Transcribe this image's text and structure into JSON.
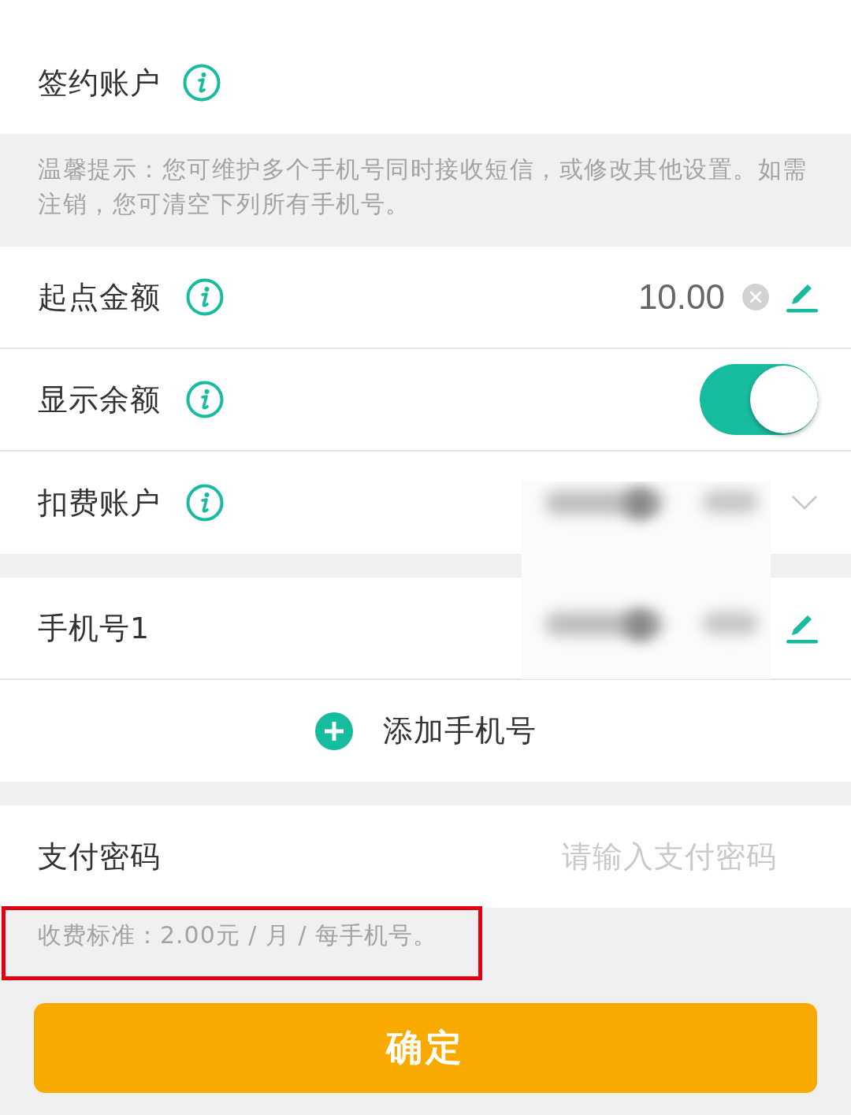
{
  "signing_account": {
    "label": "签约账户",
    "info": true
  },
  "tip": "温馨提示：您可维护多个手机号同时接收短信，或修改其他设置。如需注销，您可清空下列所有手机号。",
  "settings": [
    {
      "kind": "amount",
      "label": "起点金额",
      "info": true,
      "value": "10.00"
    },
    {
      "kind": "toggle",
      "label": "显示余额",
      "info": true,
      "on": true
    },
    {
      "kind": "select",
      "label": "扣费账户",
      "info": true,
      "masked": true
    }
  ],
  "phones": [
    {
      "label": "手机号1",
      "masked": true
    }
  ],
  "add_phone": {
    "label": "添加手机号"
  },
  "password": {
    "label": "支付密码",
    "placeholder": "请输入支付密码"
  },
  "fee_note": {
    "text": "收费标准：2.00元 / 月 / 每手机号。",
    "highlighted": true
  },
  "confirm_button": "确定"
}
